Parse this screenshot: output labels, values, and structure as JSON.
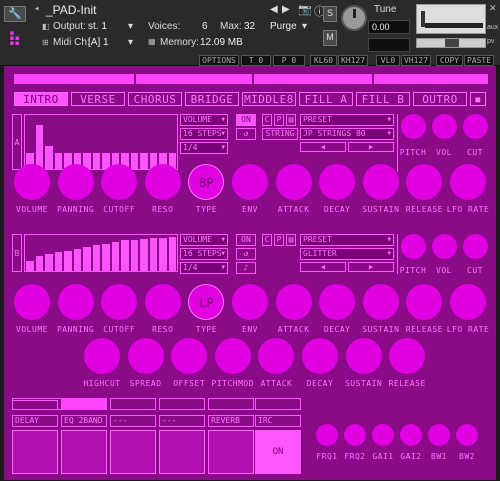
{
  "header": {
    "instrument_name": "_PAD-Init",
    "output_label": "Output:",
    "output_value": "st. 1",
    "voices_label": "Voices:",
    "voices_value": "6",
    "max_label": "Max:",
    "max_value": "32",
    "purge_label": "Purge",
    "midi_label": "Midi Ch:",
    "midi_value": "[A] 1",
    "memory_label": "Memory:",
    "memory_value": "12.09 MB",
    "tune_label": "Tune",
    "tune_value": "0.00",
    "solo_label": "S",
    "mute_label": "M",
    "aux_label": "aux",
    "pv_label": "pv"
  },
  "status": {
    "options": "OPTIONS",
    "t": "T 0",
    "p": "P 0",
    "kl": "KL60",
    "kh": "KH127",
    "vl": "VL0",
    "vh": "VH127",
    "copy": "COPY",
    "paste": "PASTE"
  },
  "sections": [
    "INTRO",
    "VERSE",
    "CHORUS",
    "BRIDGE",
    "MIDDLE8",
    "FILL A",
    "FILL B",
    "OUTRO"
  ],
  "stop_label": "■",
  "layerA": {
    "tag": "A",
    "steps": [
      0.3,
      0.85,
      0.45,
      0.3,
      0.3,
      0.3,
      0.3,
      0.3,
      0.3,
      0.3,
      0.3,
      0.3,
      0.3,
      0.3,
      0.3,
      0.3
    ],
    "param": "VOLUME",
    "steps_count": "16 STEPS",
    "rate": "1/4",
    "on_label": "ON",
    "c_label": "C",
    "p_label": "P",
    "preset": "PRESET",
    "category": "STRING",
    "sound": "JP STRINGS 80",
    "prev": "◀",
    "next": "▶",
    "mini_knobs": [
      "PITCH",
      "VOL",
      "CUT"
    ],
    "knobs": [
      "VOLUME",
      "PANNING",
      "CUTOFF",
      "RESO",
      "TYPE",
      "ENV",
      "ATTACK",
      "DECAY",
      "SUSTAIN",
      "RELEASE",
      "LFO RATE"
    ],
    "type_value": "BP"
  },
  "layerB": {
    "tag": "B",
    "steps": [
      0.3,
      0.45,
      0.5,
      0.55,
      0.6,
      0.65,
      0.7,
      0.75,
      0.8,
      0.85,
      0.9,
      0.92,
      0.95,
      0.97,
      0.98,
      1.0
    ],
    "param": "VOLUME",
    "steps_count": "16 STEPS",
    "rate": "1/4",
    "on_label": "ON",
    "c_label": "C",
    "p_label": "P",
    "preset": "PRESET",
    "sound": "GLITTER",
    "prev": "◀",
    "next": "▶",
    "mini_knobs": [
      "PITCH",
      "VOL",
      "CUT"
    ],
    "knobs": [
      "VOLUME",
      "PANNING",
      "CUTOFF",
      "RESO",
      "TYPE",
      "ENV",
      "ATTACK",
      "DECAY",
      "SUSTAIN",
      "RELEASE",
      "LFO RATE"
    ],
    "type_value": "LP"
  },
  "row3": [
    "HIGHCUT",
    "SPREAD",
    "OFFSET",
    "PITCHMOD",
    "ATTACK",
    "DECAY",
    "SUSTAIN",
    "RELEASE"
  ],
  "fx": {
    "slots": [
      "DELAY",
      "EQ 2BAND",
      "---",
      "---",
      "REVERB",
      "IRC"
    ],
    "on_label": "ON",
    "knobs": [
      "FRQ1",
      "FRQ2",
      "GAI1",
      "GAI2",
      "BW1",
      "BW2"
    ]
  }
}
